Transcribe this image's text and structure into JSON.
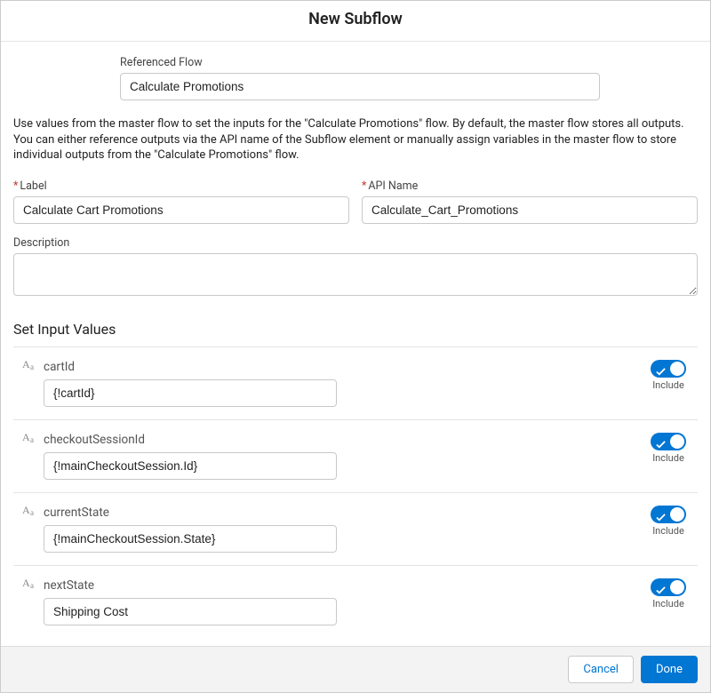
{
  "header": {
    "title": "New Subflow"
  },
  "referencedFlow": {
    "label": "Referenced Flow",
    "value": "Calculate Promotions"
  },
  "helpText": "Use values from the master flow to set the inputs for the \"Calculate Promotions\" flow. By default, the master flow stores all outputs. You can either reference outputs via the API name of the Subflow element or manually assign variables in the master flow to store individual outputs from the \"Calculate Promotions\" flow.",
  "labelField": {
    "label": "Label",
    "value": "Calculate Cart Promotions"
  },
  "apiNameField": {
    "label": "API Name",
    "value": "Calculate_Cart_Promotions"
  },
  "descriptionField": {
    "label": "Description",
    "value": ""
  },
  "inputSection": {
    "title": "Set Input Values",
    "includeLabel": "Include",
    "rows": [
      {
        "name": "cartId",
        "value": "{!cartId}"
      },
      {
        "name": "checkoutSessionId",
        "value": "{!mainCheckoutSession.Id}"
      },
      {
        "name": "currentState",
        "value": "{!mainCheckoutSession.State}"
      },
      {
        "name": "nextState",
        "value": "Shipping Cost"
      }
    ]
  },
  "footer": {
    "cancel": "Cancel",
    "done": "Done"
  }
}
